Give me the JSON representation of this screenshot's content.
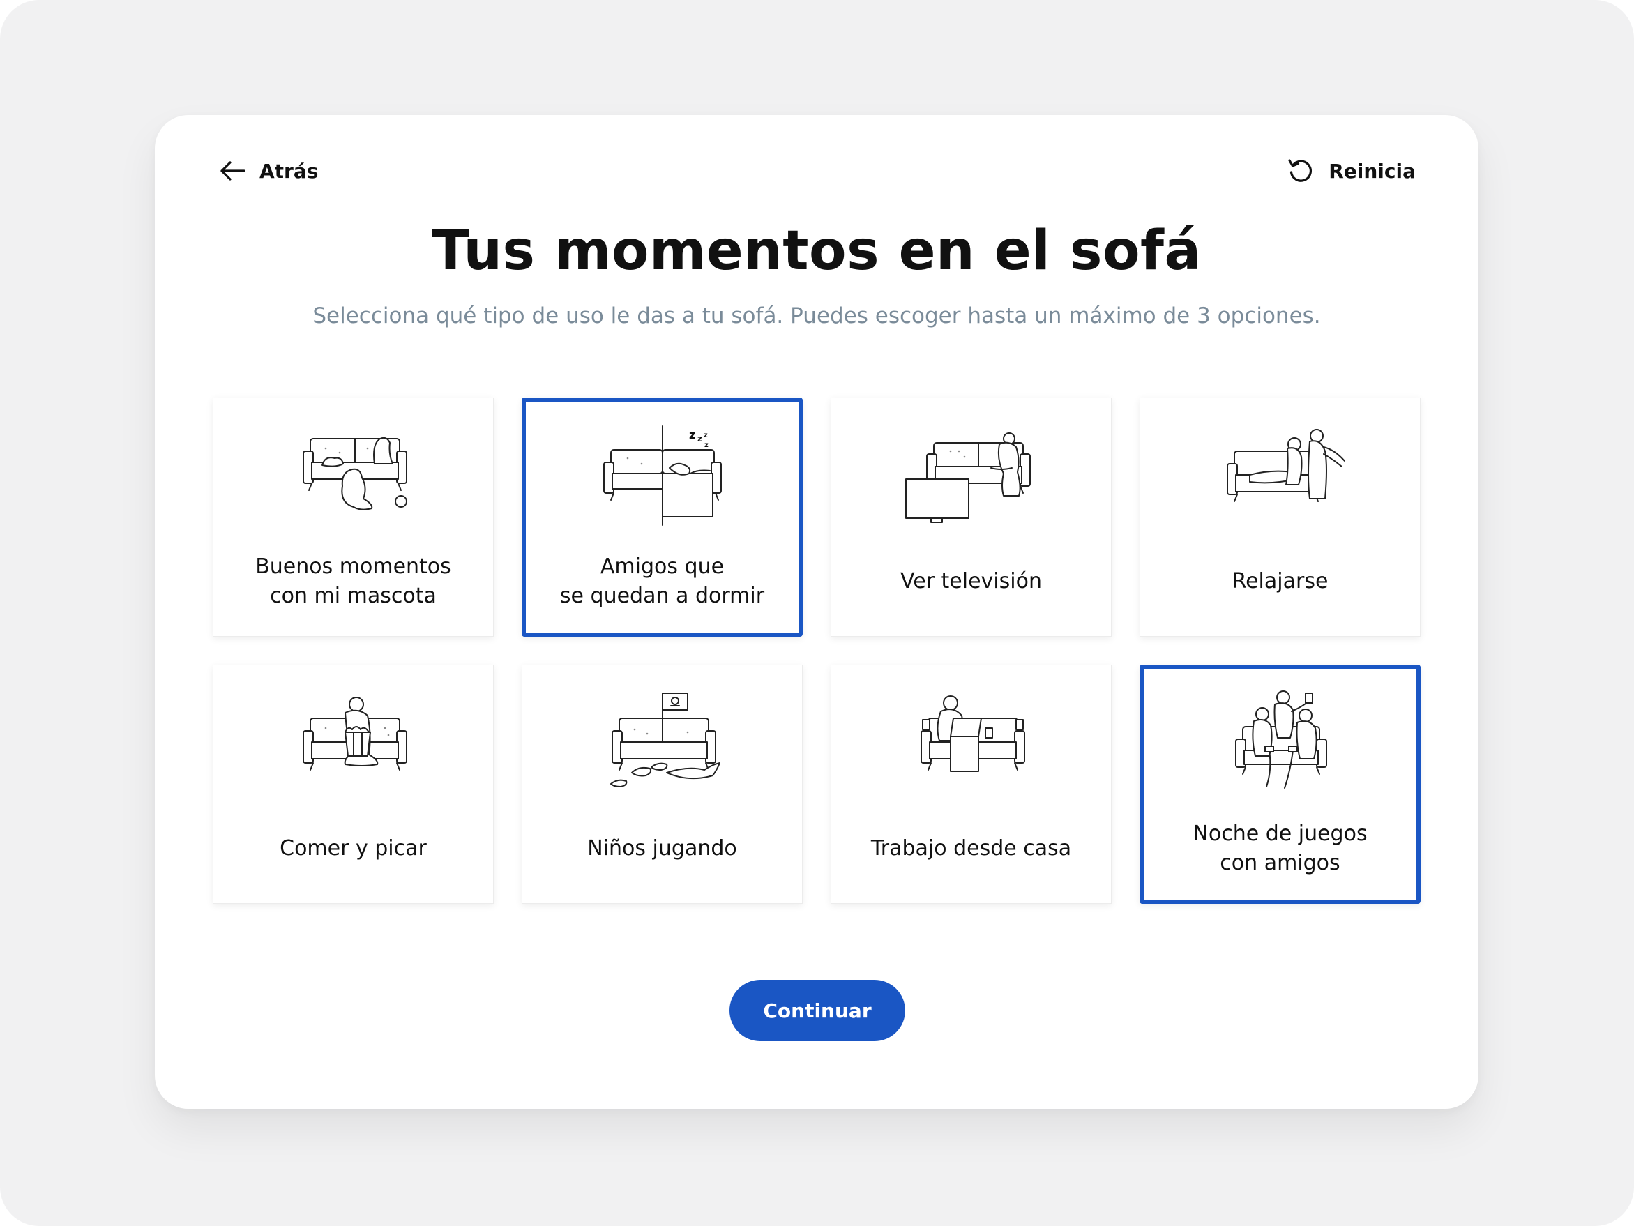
{
  "header": {
    "back_label": "Atrás",
    "back_icon": "arrow-left-icon",
    "reset_label": "Reinicia",
    "reset_icon": "reset-icon"
  },
  "title": "Tus momentos en el sofá",
  "subtitle": "Selecciona qué tipo de uso le das a tu sofá. Puedes escoger hasta un máximo de 3 opciones.",
  "options": [
    {
      "label": "Buenos momentos\ncon mi mascota",
      "icon": "sofa-pet-icon",
      "selected": false
    },
    {
      "label": "Amigos que\nse quedan a dormir",
      "icon": "sofa-bed-icon",
      "selected": true
    },
    {
      "label": "Ver televisión",
      "icon": "sofa-tv-icon",
      "selected": false
    },
    {
      "label": "Relajarse",
      "icon": "sofa-relax-icon",
      "selected": false
    },
    {
      "label": "Comer y picar",
      "icon": "sofa-popcorn-icon",
      "selected": false
    },
    {
      "label": "Niños jugando",
      "icon": "sofa-kids-icon",
      "selected": false
    },
    {
      "label": "Trabajo desde casa",
      "icon": "sofa-laptop-icon",
      "selected": false
    },
    {
      "label": "Noche de juegos\ncon amigos",
      "icon": "sofa-game-night-icon",
      "selected": true
    }
  ],
  "continue_label": "Continuar",
  "colors": {
    "accent": "#1a56c4",
    "subtitle": "#7a8b99",
    "backdrop": "#f1f1f2"
  }
}
